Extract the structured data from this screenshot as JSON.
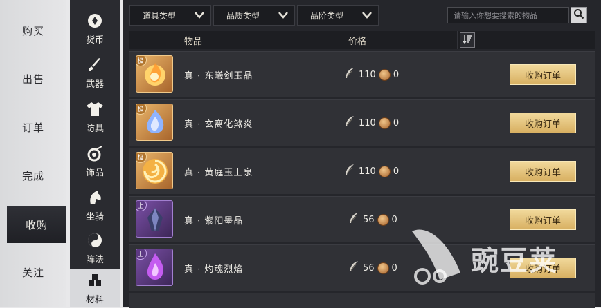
{
  "left_nav": {
    "items": [
      {
        "label": "购买"
      },
      {
        "label": "出售"
      },
      {
        "label": "订单"
      },
      {
        "label": "完成"
      },
      {
        "label": "收购",
        "active": true
      },
      {
        "label": "关注"
      }
    ]
  },
  "categories": [
    {
      "label": "货币",
      "icon": "currency-icon"
    },
    {
      "label": "武器",
      "icon": "sword-icon"
    },
    {
      "label": "防具",
      "icon": "armor-icon"
    },
    {
      "label": "饰品",
      "icon": "accessory-icon"
    },
    {
      "label": "坐骑",
      "icon": "mount-icon"
    },
    {
      "label": "阵法",
      "icon": "formation-icon"
    },
    {
      "label": "材料",
      "icon": "materials-icon",
      "active": true
    }
  ],
  "filters": {
    "item_type": "道具类型",
    "quality_type": "品质类型",
    "tier_type": "品阶类型",
    "search_placeholder": "请输入你想要搜索的物品"
  },
  "table": {
    "col_item": "物品",
    "col_price": "价格",
    "rows": [
      {
        "badge": "极",
        "rarity": "gold",
        "name": "真 · 东曦剑玉晶",
        "price": "110",
        "coins": "0",
        "button": "收购订单"
      },
      {
        "badge": "极",
        "rarity": "gold",
        "name": "真 · 玄离化煞炎",
        "price": "110",
        "coins": "0",
        "button": "收购订单"
      },
      {
        "badge": "极",
        "rarity": "gold",
        "name": "真 · 黄庭玉上泉",
        "price": "110",
        "coins": "0",
        "button": "收购订单"
      },
      {
        "badge": "上",
        "rarity": "purple",
        "name": "真 · 紫阳墨晶",
        "price": "56",
        "coins": "0",
        "button": "收购订单"
      },
      {
        "badge": "上",
        "rarity": "purple",
        "name": "真 · 灼魂烈焰",
        "price": "56",
        "coins": "0",
        "button": "收购订单"
      }
    ]
  },
  "watermark": "豌豆荚",
  "colors": {
    "gold_button": "#e2c07a",
    "rarity_gold": "#c98a3e",
    "rarity_purple": "#6f46a0",
    "panel_dark": "#25262b"
  }
}
